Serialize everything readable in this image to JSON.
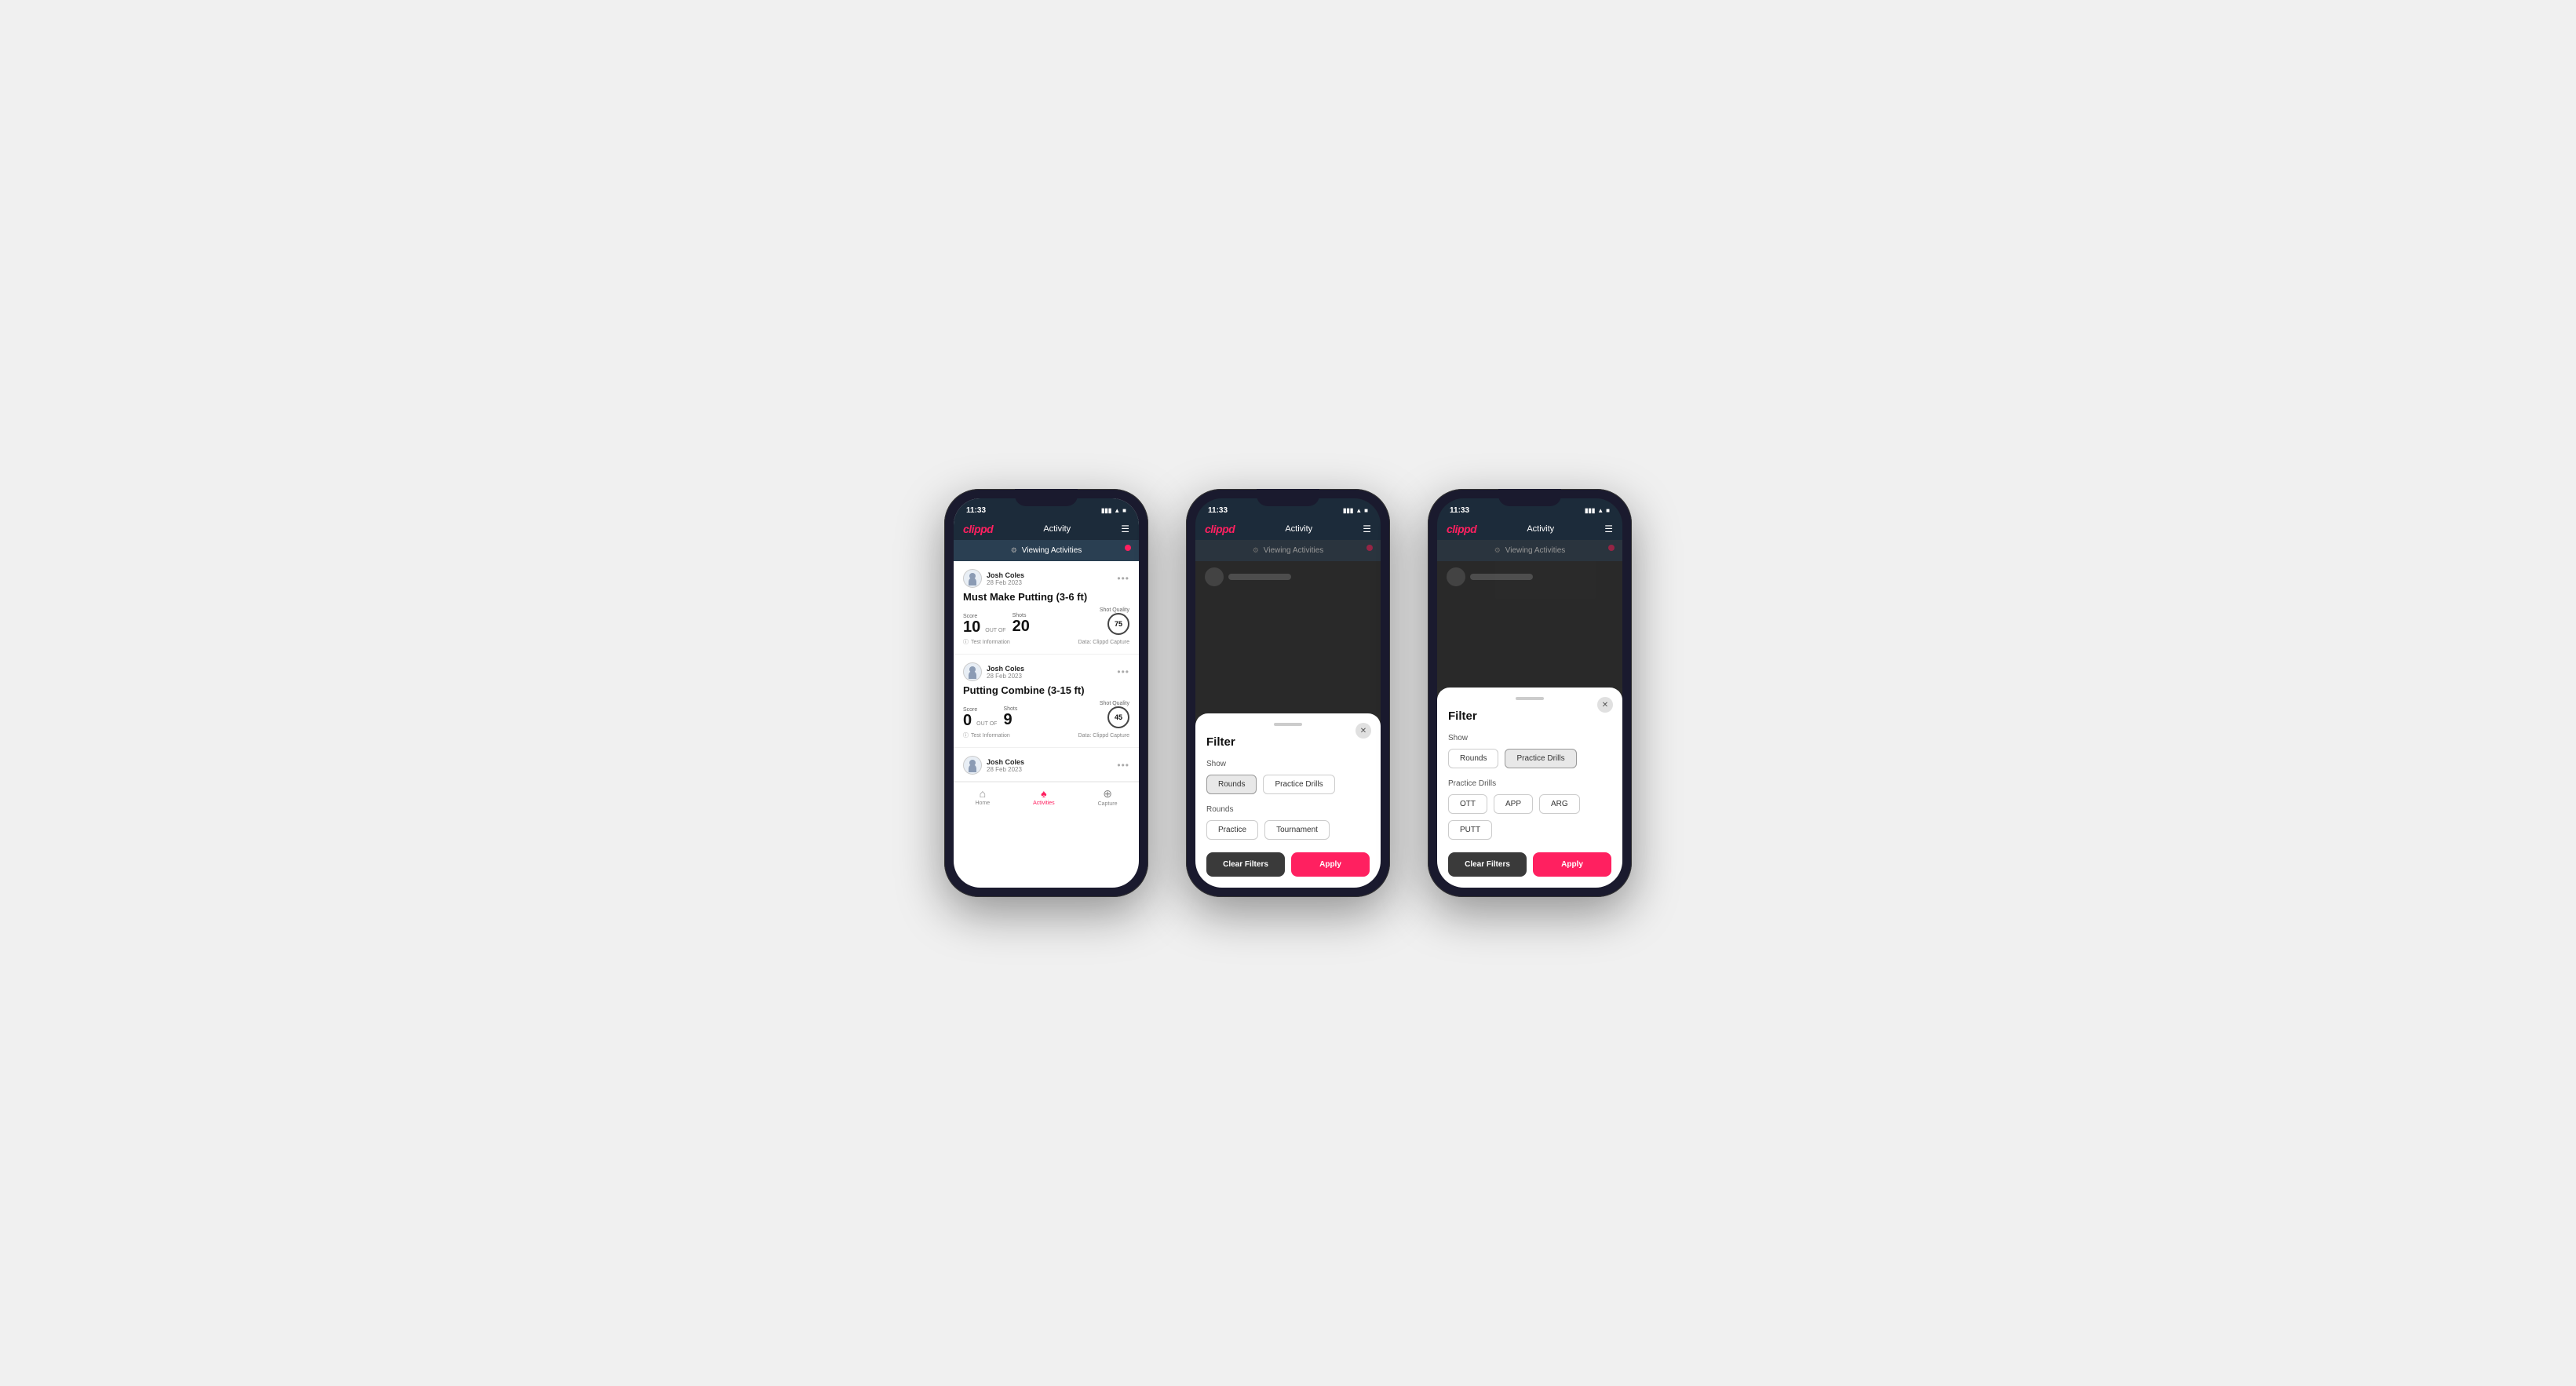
{
  "app": {
    "time": "11:33",
    "logo": "clippd",
    "nav_title": "Activity",
    "viewing_label": "Viewing Activities"
  },
  "phone1": {
    "activities": [
      {
        "user": "Josh Coles",
        "date": "28 Feb 2023",
        "title": "Must Make Putting (3-6 ft)",
        "score_label": "Score",
        "score": "10",
        "out_of_label": "OUT OF",
        "shots_label": "Shots",
        "shots": "20",
        "sq_label": "Shot Quality",
        "sq": "75",
        "info": "Test Information",
        "data": "Data: Clippd Capture"
      },
      {
        "user": "Josh Coles",
        "date": "28 Feb 2023",
        "title": "Putting Combine (3-15 ft)",
        "score_label": "Score",
        "score": "0",
        "out_of_label": "OUT OF",
        "shots_label": "Shots",
        "shots": "9",
        "sq_label": "Shot Quality",
        "sq": "45",
        "info": "Test Information",
        "data": "Data: Clippd Capture"
      },
      {
        "user": "Josh Coles",
        "date": "28 Feb 2023",
        "title": "",
        "score_label": "",
        "score": "",
        "out_of_label": "",
        "shots_label": "",
        "shots": "",
        "sq_label": "",
        "sq": "",
        "info": "",
        "data": ""
      }
    ],
    "tabs": [
      {
        "label": "Home",
        "icon": "⌂",
        "active": false
      },
      {
        "label": "Activities",
        "icon": "♟",
        "active": true
      },
      {
        "label": "Capture",
        "icon": "+",
        "active": false
      }
    ]
  },
  "phone2": {
    "filter_title": "Filter",
    "show_label": "Show",
    "show_options": [
      {
        "label": "Rounds",
        "active": true
      },
      {
        "label": "Practice Drills",
        "active": false
      }
    ],
    "rounds_label": "Rounds",
    "round_options": [
      {
        "label": "Practice",
        "active": false
      },
      {
        "label": "Tournament",
        "active": false
      }
    ],
    "clear_label": "Clear Filters",
    "apply_label": "Apply"
  },
  "phone3": {
    "filter_title": "Filter",
    "show_label": "Show",
    "show_options": [
      {
        "label": "Rounds",
        "active": false
      },
      {
        "label": "Practice Drills",
        "active": true
      }
    ],
    "drills_label": "Practice Drills",
    "drill_options": [
      {
        "label": "OTT",
        "active": false
      },
      {
        "label": "APP",
        "active": false
      },
      {
        "label": "ARG",
        "active": false
      },
      {
        "label": "PUTT",
        "active": false
      }
    ],
    "clear_label": "Clear Filters",
    "apply_label": "Apply"
  }
}
